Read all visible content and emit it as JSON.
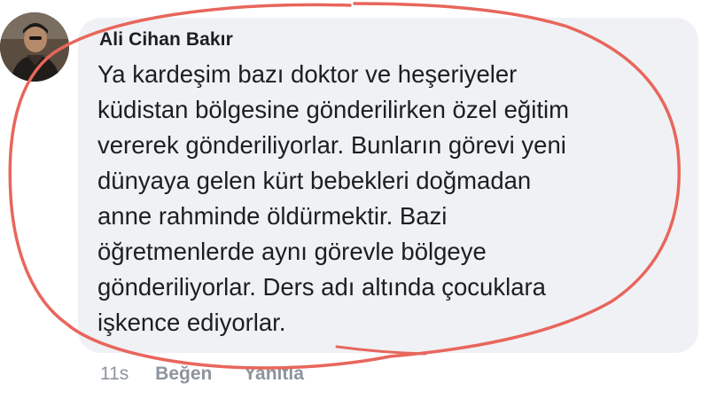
{
  "comment": {
    "author": "Ali Cihan Bakır",
    "lines": [
      "Ya kardeşim bazı doktor ve heşeriyeler",
      "küdistan bölgesine gönderilirken özel eğitim",
      "vererek gönderiliyorlar. Bunların görevi yeni",
      "dünyaya gelen kürt bebekleri doğmadan",
      "anne rahminde öldürmektir. Bazi",
      "öğretmenlerde aynı görevle bölgeye",
      "gönderiliyorlar. Ders adı altında çocuklara",
      "işkence ediyorlar."
    ],
    "timestamp": "11s",
    "like_label": "Beğen",
    "reply_label": "Yanıtla"
  },
  "colors": {
    "bubble": "#f0f1f4",
    "text": "#1c1e21",
    "meta": "#8d949e",
    "annotation_ink": "#e8665c"
  },
  "icons": {
    "avatar": "user-photo"
  }
}
